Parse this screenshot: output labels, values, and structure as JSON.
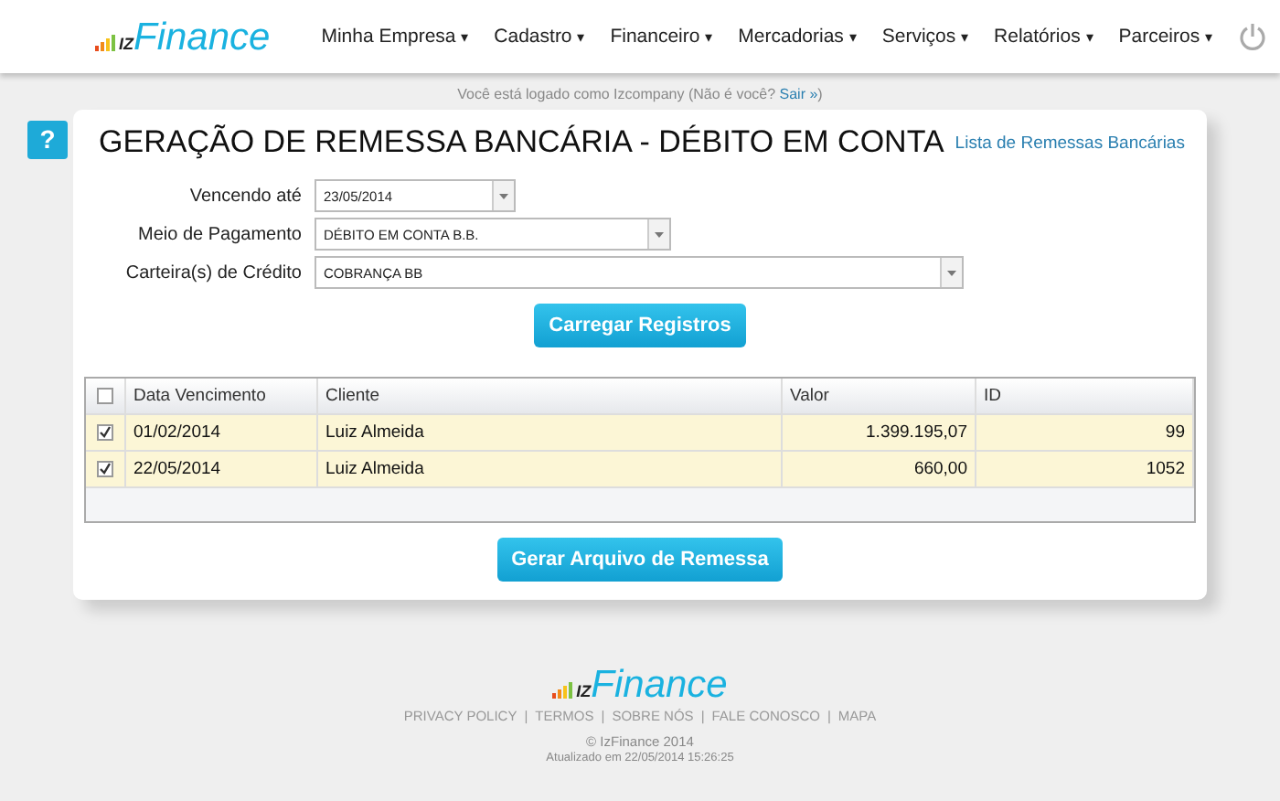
{
  "logo": {
    "mark": "IZ",
    "name": "Finance"
  },
  "nav": [
    "Minha Empresa",
    "Cadastro",
    "Financeiro",
    "Mercadorias",
    "Serviços",
    "Relatórios",
    "Parceiros"
  ],
  "nav_caret": "▾",
  "login": {
    "before": "Você está logado como Izcompany (Não é você? ",
    "link": "Sair »",
    "after": ")"
  },
  "help_badge": "?",
  "title": "GERAÇÃO DE REMESSA BANCÁRIA - DÉBITO EM CONTA",
  "list_link": "Lista de Remessas Bancárias",
  "form": [
    {
      "label": "Vencendo até",
      "value": "23/05/2014"
    },
    {
      "label": "Meio de Pagamento",
      "value": "DÉBITO EM CONTA B.B."
    },
    {
      "label": "Carteira(s) de Crédito",
      "value": "COBRANÇA BB"
    }
  ],
  "load_button": "Carregar Registros",
  "table": {
    "header_checked": false,
    "columns": [
      "Data Vencimento",
      "Cliente",
      "Valor",
      "ID"
    ],
    "rows": [
      {
        "checked": true,
        "cells": [
          "01/02/2014",
          "Luiz Almeida",
          "1.399.195,07",
          "99"
        ]
      },
      {
        "checked": true,
        "cells": [
          "22/05/2014",
          "Luiz Almeida",
          "660,00",
          "1052"
        ]
      }
    ]
  },
  "generate_button": "Gerar Arquivo de Remessa",
  "footer": {
    "logo": {
      "mark": "IZ",
      "name": "Finance"
    },
    "links": [
      "PRIVACY POLICY",
      "TERMOS",
      "SOBRE NÓS",
      "FALE CONOSCO",
      "MAPA"
    ],
    "separator": "|",
    "copyright": "© IzFinance 2014",
    "updated": "Atualizado em 22/05/2014 15:26:25"
  }
}
